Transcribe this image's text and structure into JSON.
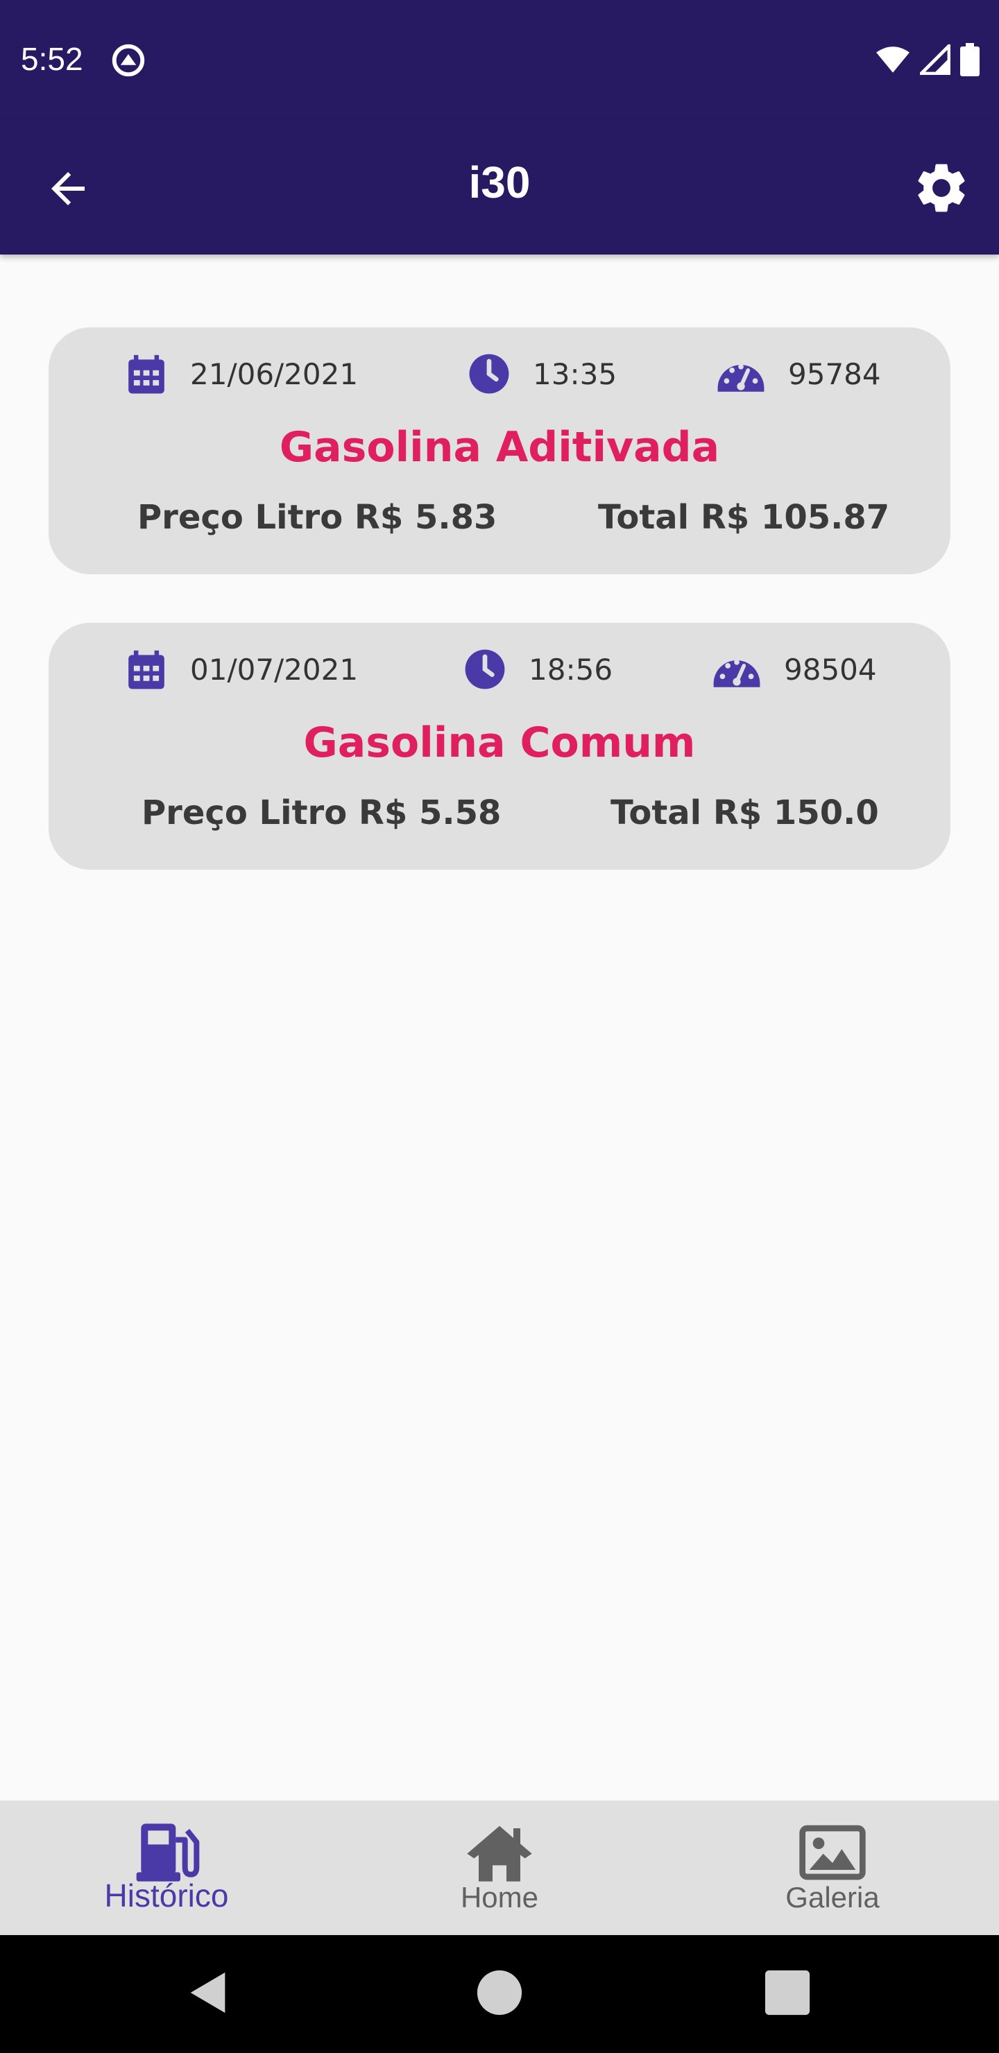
{
  "status_bar": {
    "time": "5:52"
  },
  "app_bar": {
    "title": "i30"
  },
  "colors": {
    "primary": "#281963",
    "accent": "#e01f5e",
    "icon": "#4a3aa8"
  },
  "entries": [
    {
      "date": "21/06/2021",
      "time": "13:35",
      "odometer": "95784",
      "fuel": "Gasolina Aditivada",
      "price_label": "Preço Litro R$ 5.83",
      "total_label": "Total R$ 105.87"
    },
    {
      "date": "01/07/2021",
      "time": "18:56",
      "odometer": "98504",
      "fuel": "Gasolina Comum",
      "price_label": "Preço Litro R$ 5.58",
      "total_label": "Total R$ 150.0"
    }
  ],
  "bottom_nav": {
    "items": [
      {
        "label": "Histórico",
        "icon": "gas-pump-icon",
        "active": true
      },
      {
        "label": "Home",
        "icon": "home-icon",
        "active": false
      },
      {
        "label": "Galeria",
        "icon": "image-icon",
        "active": false
      }
    ]
  }
}
